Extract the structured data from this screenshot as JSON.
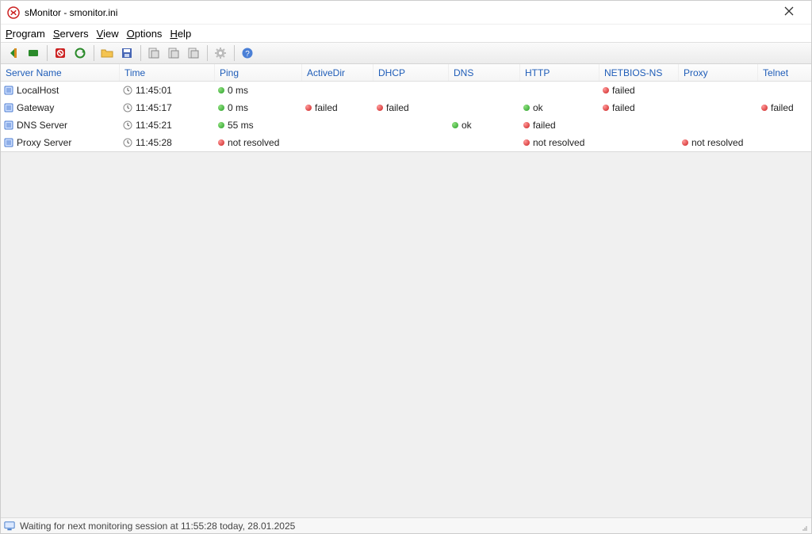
{
  "window": {
    "title": "sMonitor - smonitor.ini"
  },
  "menu": {
    "program": "Program",
    "servers": "Servers",
    "view": "View",
    "options": "Options",
    "help": "Help"
  },
  "toolbar": {
    "prev": "previous",
    "next": "next",
    "stop": "stop",
    "refresh": "refresh",
    "open": "open",
    "save": "save",
    "report1": "report-a",
    "report2": "report-b",
    "report3": "report-c",
    "settings": "settings",
    "help": "help"
  },
  "columns": [
    "Server Name",
    "Time",
    "Ping",
    "ActiveDir",
    "DHCP",
    "DNS",
    "HTTP",
    "NETBIOS-NS",
    "Proxy",
    "Telnet"
  ],
  "rows": [
    {
      "name": "LocalHost",
      "time": "11:45:01",
      "cells": {
        "ping": {
          "status": "ok",
          "text": "0 ms"
        },
        "activedir": null,
        "dhcp": null,
        "dns": null,
        "http": null,
        "netbios": {
          "status": "fail",
          "text": "failed"
        },
        "proxy": null,
        "telnet": null
      }
    },
    {
      "name": "Gateway",
      "time": "11:45:17",
      "cells": {
        "ping": {
          "status": "ok",
          "text": "0 ms"
        },
        "activedir": {
          "status": "fail",
          "text": "failed"
        },
        "dhcp": {
          "status": "fail",
          "text": "failed"
        },
        "dns": null,
        "http": {
          "status": "ok",
          "text": "ok"
        },
        "netbios": {
          "status": "fail",
          "text": "failed"
        },
        "proxy": null,
        "telnet": {
          "status": "fail",
          "text": "failed"
        }
      }
    },
    {
      "name": "DNS Server",
      "time": "11:45:21",
      "cells": {
        "ping": {
          "status": "ok",
          "text": "55 ms"
        },
        "activedir": null,
        "dhcp": null,
        "dns": {
          "status": "ok",
          "text": "ok"
        },
        "http": {
          "status": "fail",
          "text": "failed"
        },
        "netbios": null,
        "proxy": null,
        "telnet": null
      }
    },
    {
      "name": "Proxy Server",
      "time": "11:45:28",
      "cells": {
        "ping": {
          "status": "fail",
          "text": "not resolved"
        },
        "activedir": null,
        "dhcp": null,
        "dns": null,
        "http": {
          "status": "fail",
          "text": "not resolved"
        },
        "netbios": null,
        "proxy": {
          "status": "fail",
          "text": "not resolved"
        },
        "telnet": null
      }
    }
  ],
  "status": {
    "text": "Waiting for next monitoring session at 11:55:28 today, 28.01.2025"
  }
}
